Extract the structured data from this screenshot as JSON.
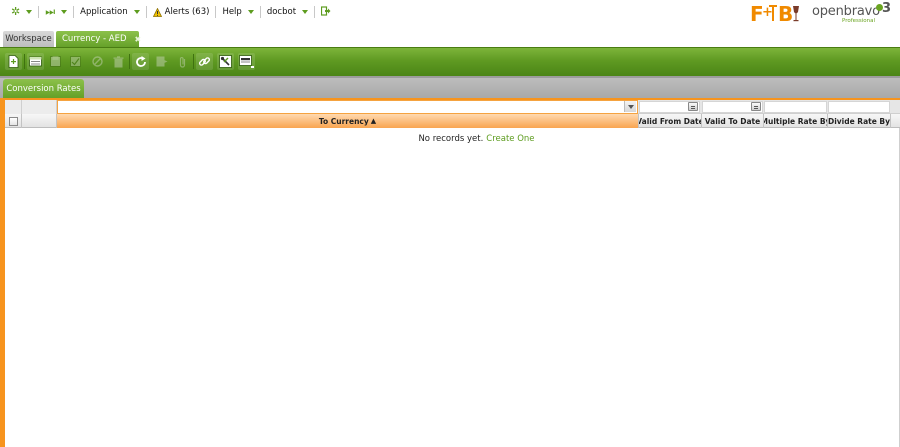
{
  "topnav": {
    "application_label": "Application",
    "alerts_label": "Alerts (63)",
    "help_label": "Help",
    "user_label": "docbot"
  },
  "brand": {
    "client_logo_text": "F+B",
    "product_name": "openbravo",
    "product_version": "3",
    "edition": "Professional"
  },
  "window_tabs": [
    {
      "label": "Workspace",
      "active": false
    },
    {
      "label": "Currency - AED",
      "active": true
    }
  ],
  "toolbar": {
    "buttons": [
      {
        "icon": "new-document-icon",
        "enabled": true
      },
      {
        "icon": "new-row-icon",
        "enabled": true
      },
      {
        "icon": "save-icon",
        "enabled": false
      },
      {
        "icon": "save-close-icon",
        "enabled": false
      },
      {
        "icon": "undo-icon",
        "enabled": false
      },
      {
        "icon": "delete-icon",
        "enabled": false
      },
      {
        "icon": "refresh-icon",
        "enabled": true
      },
      {
        "icon": "export-icon",
        "enabled": false
      },
      {
        "icon": "attach-icon",
        "enabled": false
      },
      {
        "icon": "link-icon",
        "enabled": true
      },
      {
        "icon": "tools-icon",
        "enabled": true
      },
      {
        "icon": "grid-view-icon",
        "enabled": true
      }
    ]
  },
  "sub_tabs": [
    {
      "label": "Conversion Rates",
      "active": true
    }
  ],
  "grid": {
    "columns": [
      {
        "label": "To Currency",
        "sorted": "asc"
      },
      {
        "label": "Valid From Date"
      },
      {
        "label": "Valid To Date"
      },
      {
        "label": "Multiple Rate By"
      },
      {
        "label": "Divide Rate By"
      }
    ],
    "sort_glyph": "▲",
    "empty_message": "No records yet.",
    "empty_action": "Create One"
  },
  "colors": {
    "brand_green": "#5d9c1f",
    "accent_orange": "#f7941e",
    "toolbar_green": "#5f9a22"
  }
}
